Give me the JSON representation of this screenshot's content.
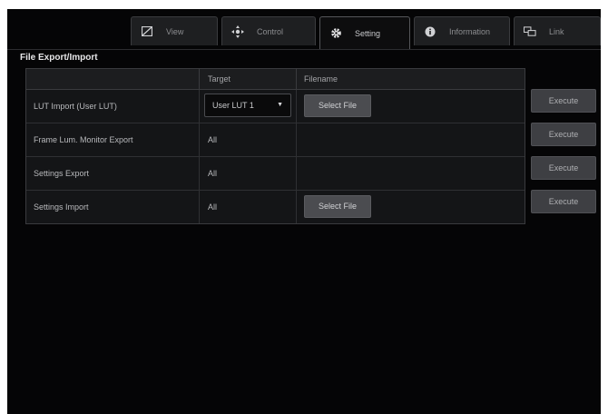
{
  "tabs": [
    {
      "label": "View",
      "icon": "view-icon",
      "active": false
    },
    {
      "label": "Control",
      "icon": "control-icon",
      "active": false
    },
    {
      "label": "Setting",
      "icon": "gear-icon",
      "active": true
    },
    {
      "label": "Information",
      "icon": "info-icon",
      "active": false
    },
    {
      "label": "Link",
      "icon": "link-icon",
      "active": false
    }
  ],
  "section": {
    "title": "File Export/Import"
  },
  "table": {
    "headers": {
      "target": "Target",
      "filename": "Filename"
    },
    "rows": [
      {
        "label": "LUT Import (User LUT)",
        "target": "User LUT 1",
        "target_is_dropdown": true,
        "filename_button": "Select File",
        "execute": "Execute"
      },
      {
        "label": "Frame Lum. Monitor Export",
        "target": "All",
        "filename_button": "",
        "execute": "Execute"
      },
      {
        "label": "Settings Export",
        "target": "All",
        "filename_button": "",
        "execute": "Execute"
      },
      {
        "label": "Settings Import",
        "target": "All",
        "filename_button": "Select File",
        "execute": "Execute"
      }
    ]
  },
  "colors": {
    "background": "#050506",
    "panel": "#141517",
    "button": "#4b4c50",
    "text": "#b8b9bc"
  }
}
